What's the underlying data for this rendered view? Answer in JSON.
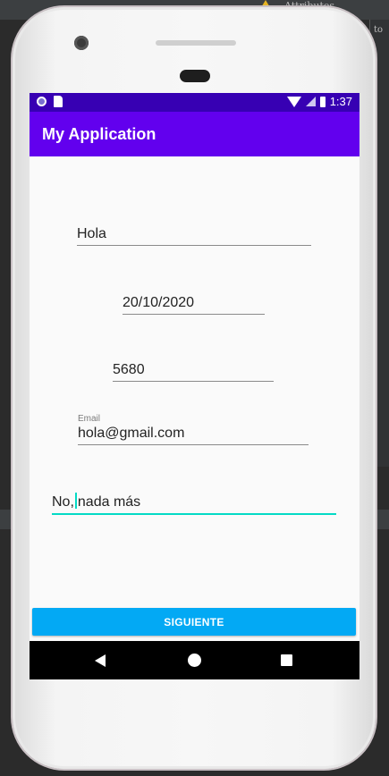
{
  "ide": {
    "attributes_label": "Attributes",
    "side_label": "to"
  },
  "status_bar": {
    "time": "1:37"
  },
  "app_bar": {
    "title": "My Application"
  },
  "form": {
    "field1_value": "Hola",
    "field2_value": "20/10/2020",
    "field3_value": "5680",
    "email_hint": "Email",
    "email_value": "hola@gmail.com",
    "field5_value_before_caret": "No,",
    "field5_value_after_caret": "nada más"
  },
  "button": {
    "label": "SIGUIENTE"
  },
  "colors": {
    "status_bar": "#3700b3",
    "app_bar": "#6200ee",
    "button": "#03a9f4",
    "accent_underline": "#03dac5"
  },
  "icons": {
    "status_left": [
      "circle-icon",
      "sd-card-icon"
    ],
    "status_right": [
      "wifi-icon",
      "signal-icon",
      "battery-icon"
    ],
    "nav": [
      "back-icon",
      "home-icon",
      "recents-icon"
    ]
  }
}
